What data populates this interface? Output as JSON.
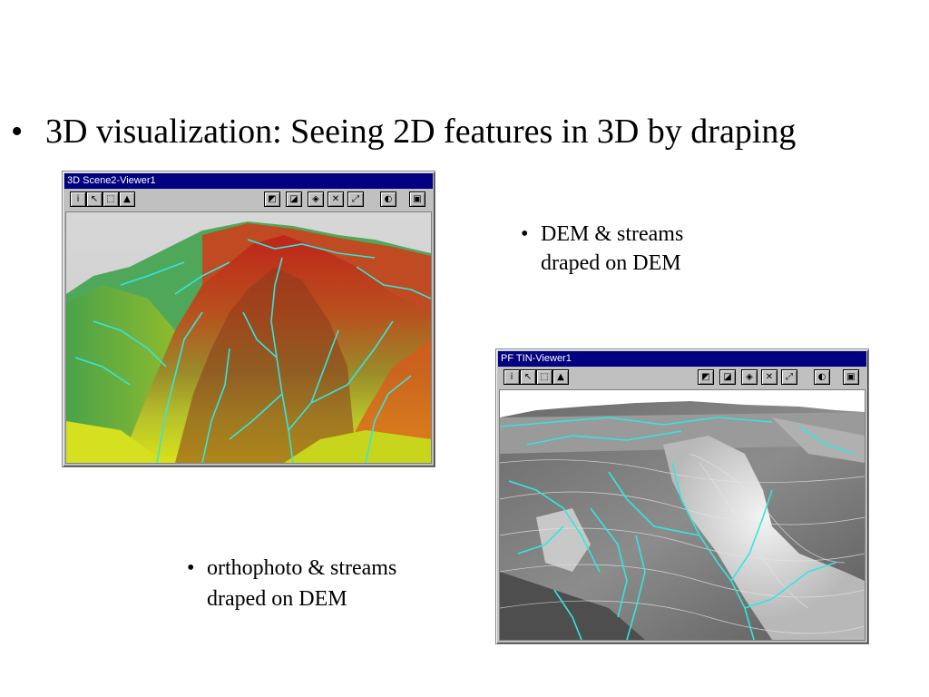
{
  "slide": {
    "main_bullet": "3D visualization: Seeing 2D features in 3D by draping",
    "bullet_char": "•"
  },
  "viewer1": {
    "title": "3D Scene2-Viewer1",
    "caption": [
      "DEM & streams",
      "draped on DEM"
    ]
  },
  "viewer2": {
    "title": "PF TIN-Viewer1",
    "caption": [
      "orthophoto & streams",
      "draped on DEM"
    ]
  },
  "toolbar_icons": {
    "left": [
      "identify-icon",
      "select-icon",
      "select-features-icon",
      "scene-properties-icon"
    ],
    "right": [
      "add-data-icon",
      "add-layer-icon",
      "navigate-icon",
      "zoom-in-icon",
      "full-extent-icon",
      "fly-icon",
      "save-icon"
    ]
  },
  "colors": {
    "title_bar": "#000080",
    "window_face": "#c0c0c0",
    "stream": "#33e6e0"
  }
}
